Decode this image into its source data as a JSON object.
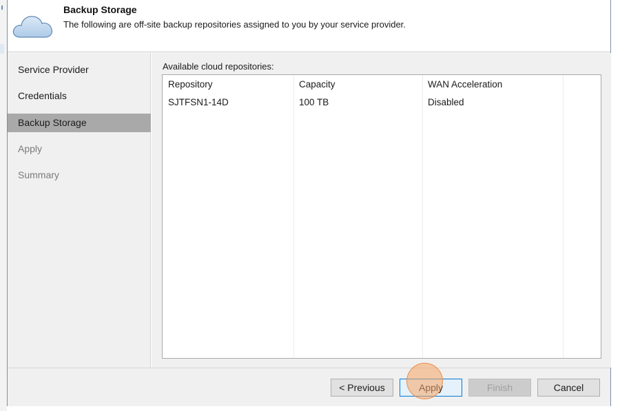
{
  "header": {
    "title": "Backup Storage",
    "description": "The following are off-site backup repositories assigned to you by your service provider.",
    "icon": "cloud-icon"
  },
  "steps": [
    {
      "label": "Service Provider",
      "state": "done"
    },
    {
      "label": "Credentials",
      "state": "done"
    },
    {
      "label": "Backup Storage",
      "state": "active"
    },
    {
      "label": "Apply",
      "state": "disabled"
    },
    {
      "label": "Summary",
      "state": "disabled"
    }
  ],
  "repositories": {
    "label": "Available cloud repositories:",
    "columns": [
      "Repository",
      "Capacity",
      "WAN Acceleration"
    ],
    "rows": [
      {
        "repository": "SJTFSN1-14D",
        "capacity": "100 TB",
        "wan_acceleration": "Disabled"
      }
    ]
  },
  "buttons": {
    "previous": "< Previous",
    "apply": "Apply",
    "finish": "Finish",
    "cancel": "Cancel"
  },
  "colors": {
    "active_step": "#a9a9a9",
    "panel_bg": "#f0f0f0",
    "primary_button_border": "#0078d7",
    "click_indicator": "#f5a664"
  }
}
